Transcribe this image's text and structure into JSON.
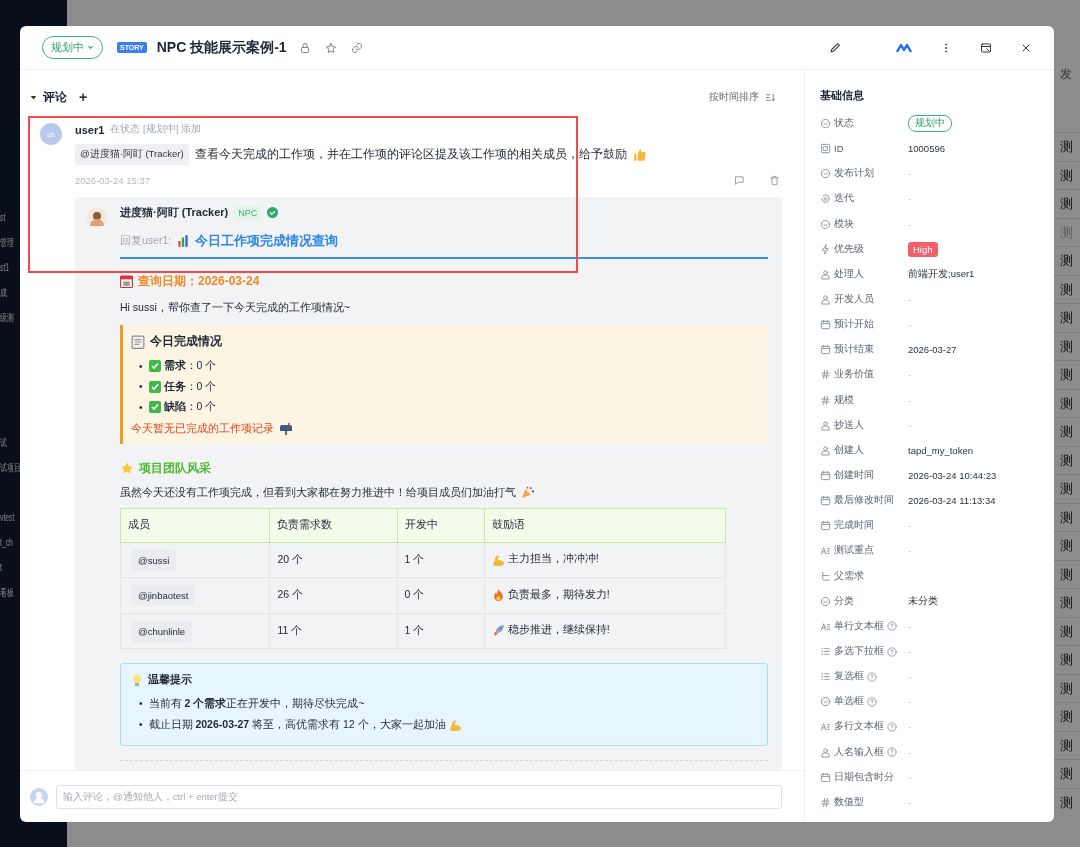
{
  "background": {
    "sidebar_fragments": [
      "st",
      "管理",
      "st1",
      "成",
      "级测",
      "试",
      "试项目",
      "vtest",
      "t_ch",
      "t",
      "看板"
    ],
    "table_column": {
      "header": "发",
      "cells": [
        {
          "text": "测",
          "disabled": false
        },
        {
          "text": "测",
          "disabled": false
        },
        {
          "text": "测",
          "disabled": false
        },
        {
          "text": "测",
          "disabled": true
        },
        {
          "text": "测",
          "disabled": false
        },
        {
          "text": "测",
          "disabled": false
        },
        {
          "text": "测",
          "disabled": false
        },
        {
          "text": "测",
          "disabled": false
        },
        {
          "text": "测",
          "disabled": false
        },
        {
          "text": "测",
          "disabled": false
        },
        {
          "text": "测",
          "disabled": false
        },
        {
          "text": "测",
          "disabled": false
        },
        {
          "text": "测",
          "disabled": false
        },
        {
          "text": "测",
          "disabled": false
        },
        {
          "text": "测",
          "disabled": false
        },
        {
          "text": "测",
          "disabled": false
        },
        {
          "text": "测",
          "disabled": false
        },
        {
          "text": "测",
          "disabled": false
        },
        {
          "text": "测",
          "disabled": false
        },
        {
          "text": "测",
          "disabled": false
        },
        {
          "text": "测",
          "disabled": false
        },
        {
          "text": "测",
          "disabled": false
        },
        {
          "text": "测",
          "disabled": false
        },
        {
          "text": "测",
          "disabled": false
        }
      ]
    }
  },
  "dialog": {
    "status": "规划中",
    "type_tag": "STORY",
    "title": "NPC 技能展示案例-1"
  },
  "comments": {
    "title": "评论",
    "add": "+",
    "sort": "按时间排序",
    "comment": {
      "avatar": "us",
      "author": "user1",
      "meta": "在状态 [规划中] 添加",
      "mention": "@进度猫·阿盯 (Tracker)",
      "text": "查看今天完成的工作项，并在工作项的评论区提及该工作项的相关成员，给予鼓励",
      "time": "2026-03-24 15:37",
      "reply": {
        "author": "进度猫·阿盯 (Tracker)",
        "badge": "NPC",
        "verified": true,
        "reply_to": "回复user1:",
        "heading": "今日工作项完成情况查询",
        "date_line": "查询日期：2026-03-24",
        "greeting": "Hi sussi，帮你查了一下今天完成的工作项情况~",
        "summary": {
          "title": "今日完成情况",
          "marker": "•",
          "items": [
            "**需求**：0 个",
            "**任务**：0 个",
            "**缺陷**：0 个"
          ],
          "note": "今天暂无已完成的工作项记录"
        },
        "team_heading": "项目团队风采",
        "team_text": "虽然今天还没有工作项完成，但看到大家都在努力推进中！给项目成员们加油打气",
        "table": {
          "columns": [
            "成员",
            "负责需求数",
            "开发中",
            "鼓励语"
          ],
          "rows": [
            [
              "@sussi",
              "20 个",
              "1 个",
              "主力担当，冲冲冲!"
            ],
            [
              "@jinbaotest",
              "26 个",
              "0 个",
              "负责最多，期待发力!"
            ],
            [
              "@chunlinle",
              "11 个",
              "1 个",
              "稳步推进，继续保持!"
            ]
          ]
        },
        "tips": {
          "title": "温馨提示",
          "marker": "•",
          "items": [
            "当前有 **2 个需求**正在开发中，期待尽快完成~",
            "截止日期 **2026-03-27** 将至，高优需求有 12 个，大家一起加油"
          ]
        }
      }
    }
  },
  "comment_input": {
    "placeholder": "输入评论，@通知他人，ctrl + enter提交"
  },
  "info_panel": {
    "title": "基础信息",
    "fields": [
      {
        "label": "状态",
        "kind": "status",
        "value": "规划中"
      },
      {
        "label": "ID",
        "kind": "text",
        "value": "1000596"
      },
      {
        "label": "发布计划",
        "kind": "empty",
        "value": "-"
      },
      {
        "label": "迭代",
        "kind": "empty",
        "value": "-"
      },
      {
        "label": "模块",
        "kind": "empty",
        "value": "-"
      },
      {
        "label": "优先级",
        "kind": "priority",
        "value": "High"
      },
      {
        "label": "处理人",
        "kind": "text",
        "value": "前端开发;user1"
      },
      {
        "label": "开发人员",
        "kind": "empty",
        "value": "-"
      },
      {
        "label": "预计开始",
        "kind": "empty",
        "value": "-"
      },
      {
        "label": "预计结束",
        "kind": "text",
        "value": "2026-03-27"
      },
      {
        "label": "业务价值",
        "kind": "empty",
        "value": "-"
      },
      {
        "label": "规模",
        "kind": "empty",
        "value": "-"
      },
      {
        "label": "抄送人",
        "kind": "empty",
        "value": "-"
      },
      {
        "label": "创建人",
        "kind": "text",
        "value": "tapd_my_token"
      },
      {
        "label": "创建时间",
        "kind": "text",
        "value": "2026-03-24 10:44:23"
      },
      {
        "label": "最后修改时间",
        "kind": "text",
        "value": "2026-03-24 11:13:34"
      },
      {
        "label": "完成时间",
        "kind": "empty",
        "value": "-"
      },
      {
        "label": "测试重点",
        "kind": "empty",
        "value": "-"
      },
      {
        "label": "父需求",
        "kind": "none"
      },
      {
        "label": "分类",
        "kind": "text",
        "value": "未分类"
      },
      {
        "label": "单行文本框",
        "kind": "empty",
        "value": "-",
        "help": true
      },
      {
        "label": "多选下拉框",
        "kind": "empty",
        "value": "-",
        "help": true
      },
      {
        "label": "复选框",
        "kind": "empty",
        "value": "-",
        "help": true
      },
      {
        "label": "单选框",
        "kind": "empty",
        "value": "-",
        "help": true
      },
      {
        "label": "多行文本框",
        "kind": "empty",
        "value": "-",
        "help": true
      },
      {
        "label": "人名输入框",
        "kind": "empty",
        "value": "-",
        "help": true
      },
      {
        "label": "日期包含时分",
        "kind": "empty",
        "value": "-"
      },
      {
        "label": "数值型",
        "kind": "empty",
        "value": "-"
      }
    ]
  }
}
